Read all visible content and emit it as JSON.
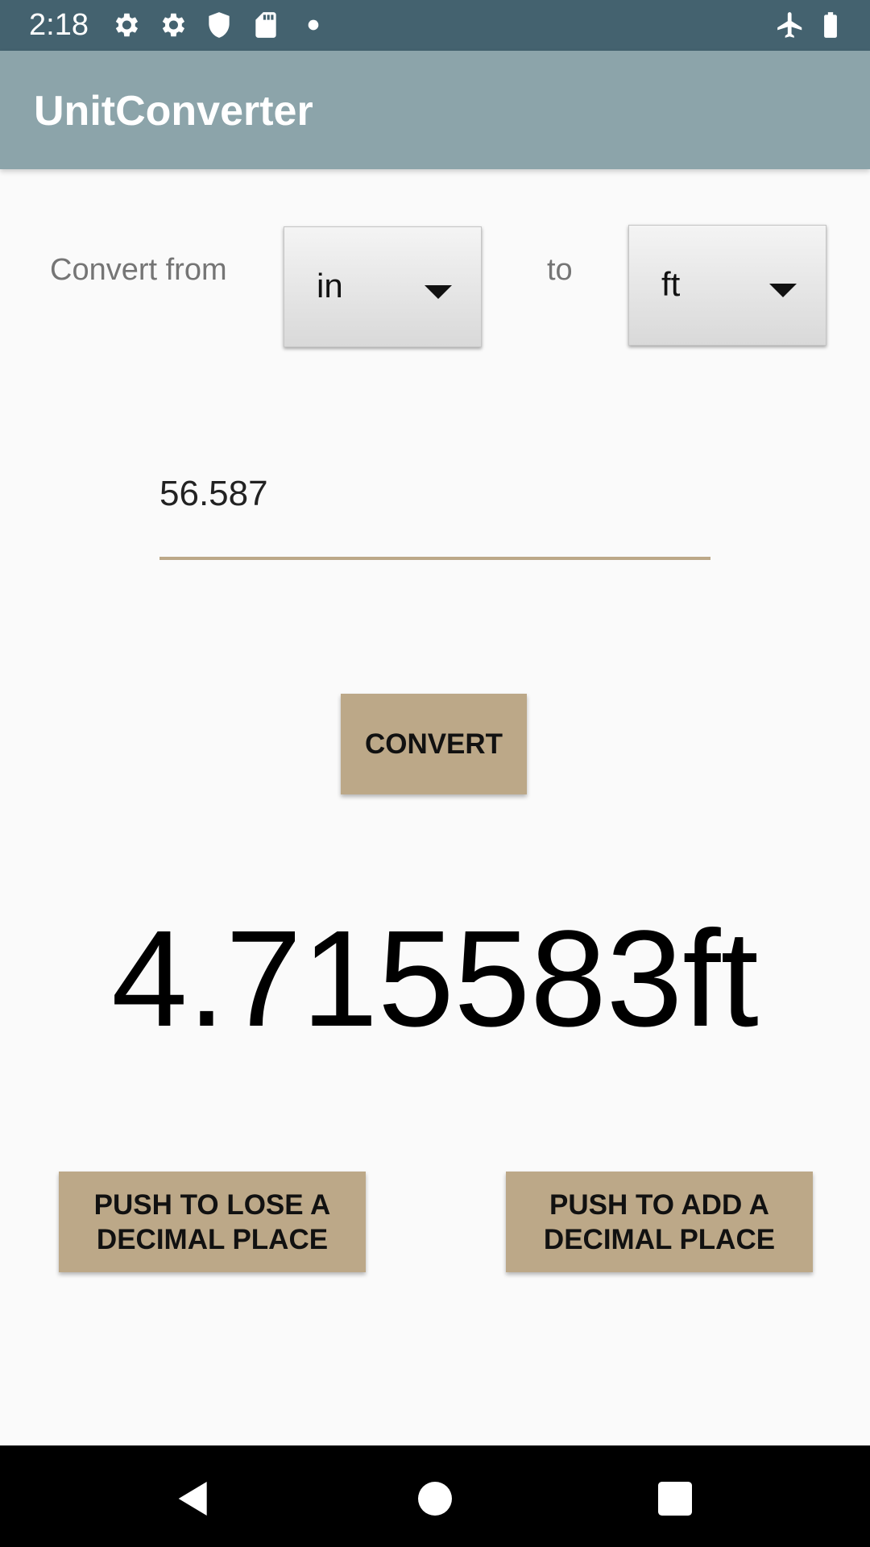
{
  "status_bar": {
    "time": "2:18",
    "icons": [
      "gear-icon",
      "gear-icon",
      "shield-icon",
      "sd-card-icon",
      "dot-icon",
      "airplane-icon",
      "battery-icon"
    ]
  },
  "app_bar": {
    "title": "UnitConverter",
    "color": "#8ca4aa"
  },
  "converter": {
    "from_label": "Convert from",
    "from_unit": "in",
    "to_label": "to",
    "to_unit": "ft",
    "input_value": "56.587",
    "convert_label": "CONVERT",
    "result": "4.715583ft"
  },
  "decimal_buttons": {
    "lose_line1": "PUSH TO LOSE A",
    "lose_line2": "DECIMAL PLACE",
    "add_line1": "PUSH TO ADD A",
    "add_line2": "DECIMAL PLACE"
  },
  "nav_bar": {
    "icons": [
      "back-icon",
      "home-icon",
      "recents-icon"
    ]
  },
  "colors": {
    "status_bar": "#44626f",
    "accent": "#bca888",
    "background": "#fafafa"
  }
}
